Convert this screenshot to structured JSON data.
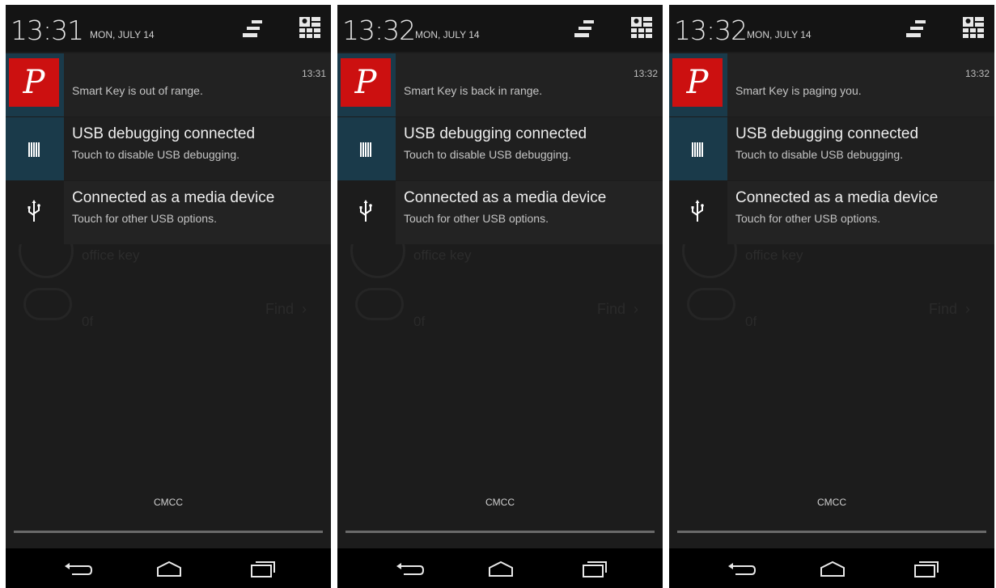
{
  "screens": [
    {
      "clock": "13:31",
      "date": "MON, JULY 14",
      "notifications": [
        {
          "app_icon_letter": "P",
          "title": "",
          "text": "Smart Key is out of range.",
          "time": "13:31"
        },
        {
          "title": "USB debugging connected",
          "text": "Touch to disable USB debugging.",
          "icon": "usb-debug-icon"
        },
        {
          "title": "Connected as a media device",
          "text": "Touch for other USB options.",
          "icon": "usb-icon"
        }
      ],
      "carrier": "CMCC",
      "background": {
        "key_name": "office key",
        "find_label": "Find",
        "zero_label": "0f"
      }
    },
    {
      "clock": "13:32",
      "date": "MON, JULY 14",
      "notifications": [
        {
          "app_icon_letter": "P",
          "title": "",
          "text": "Smart Key is back in range.",
          "time": "13:32"
        },
        {
          "title": "USB debugging connected",
          "text": "Touch to disable USB debugging.",
          "icon": "usb-debug-icon"
        },
        {
          "title": "Connected as a media device",
          "text": "Touch for other USB options.",
          "icon": "usb-icon"
        }
      ],
      "carrier": "CMCC",
      "background": {
        "key_name": "office key",
        "find_label": "Find",
        "zero_label": "0f"
      }
    },
    {
      "clock": "13:32",
      "date": "MON, JULY 14",
      "notifications": [
        {
          "app_icon_letter": "P",
          "title": "",
          "text": "Smart Key is paging you.",
          "time": "13:32"
        },
        {
          "title": "USB debugging connected",
          "text": "Touch to disable USB debugging.",
          "icon": "usb-debug-icon"
        },
        {
          "title": "Connected as a media device",
          "text": "Touch for other USB options.",
          "icon": "usb-icon"
        }
      ],
      "carrier": "CMCC",
      "background": {
        "key_name": "office key",
        "find_label": "Find",
        "zero_label": "0f"
      }
    }
  ],
  "colors": {
    "app_icon_red": "#cc1010",
    "highlight_icon_bg": "#1a3a4a",
    "shade_bg": "#1c1c1c"
  },
  "icons": {
    "clear_all": "clear-all-icon",
    "quick_settings": "quick-settings-icon",
    "back": "back-icon",
    "home": "home-icon",
    "recents": "recents-icon"
  }
}
